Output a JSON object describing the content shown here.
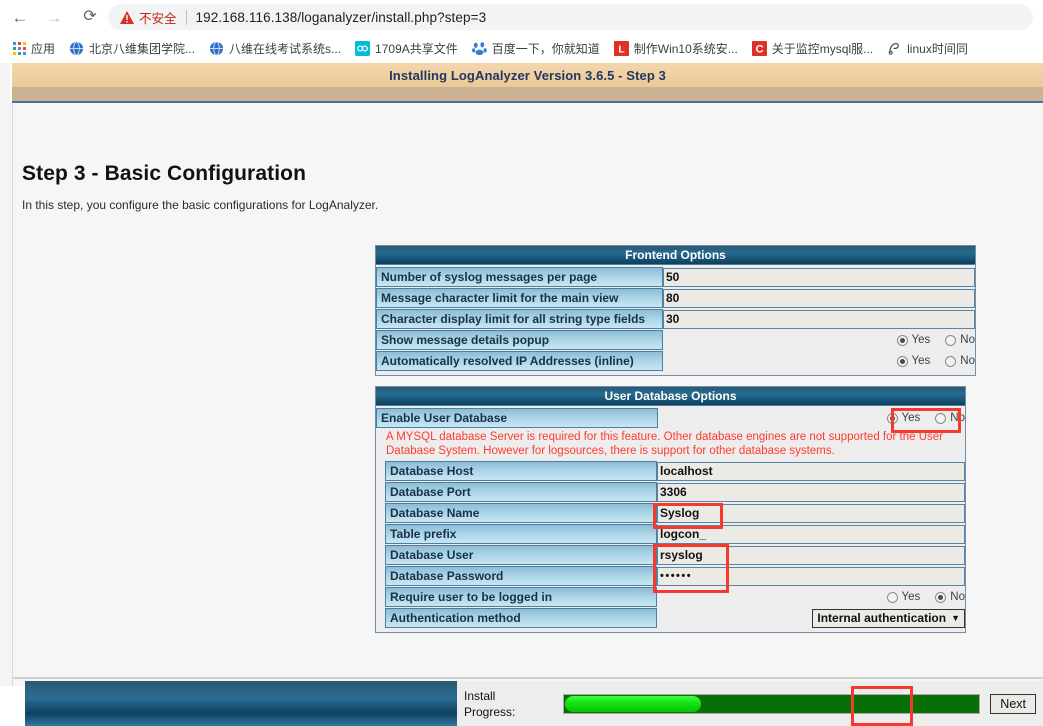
{
  "browser": {
    "back_icon": "back-arrow-icon",
    "forward_icon": "forward-arrow-icon",
    "reload_icon": "reload-icon",
    "security_label": "不安全",
    "url": "192.168.116.138/loganalyzer/install.php?step=3",
    "apps_label": "应用",
    "bookmarks": [
      {
        "label": "北京八维集团学院...",
        "icon": "globe-icon",
        "color": "#2f6fc4"
      },
      {
        "label": "八维在线考试系统s...",
        "icon": "globe-icon",
        "color": "#2f6fc4"
      },
      {
        "label": "1709A共享文件",
        "icon": "link-icon",
        "color": "#00bcd4"
      },
      {
        "label": "百度一下，你就知道",
        "icon": "baidu-icon",
        "color": "#2f7fd4"
      },
      {
        "label": "制作Win10系统安...",
        "icon": "letter-l-icon",
        "color": "#e03127"
      },
      {
        "label": "关于监控mysql服...",
        "icon": "letter-c-icon",
        "color": "#e03127"
      },
      {
        "label": "linux时间同",
        "icon": "script-icon",
        "color": "#4a4a4a"
      }
    ]
  },
  "installer": {
    "window_title": "Installing LogAnalyzer Version 3.6.5 - Step 3",
    "page_title": "Step 3 - Basic Configuration",
    "page_subtitle": "In this step, you configure the basic configurations for LogAnalyzer.",
    "colors": {
      "title_bar_bg": "#f0cfa2",
      "title_text": "#1f3864",
      "table_header_bg": "#1d5b80",
      "label_bg": "#a9d3e6",
      "warning_text": "#ff3b30",
      "annotation": "#f4392e",
      "progress_fill": "#15e015",
      "progress_track": "#067006"
    },
    "frontend_options": {
      "header": "Frontend Options",
      "rows": [
        {
          "label": "Number of syslog messages per page",
          "type": "text",
          "value": "50"
        },
        {
          "label": "Message character limit for the main view",
          "type": "text",
          "value": "80"
        },
        {
          "label": "Character display limit for all string type fields",
          "type": "text",
          "value": "30"
        },
        {
          "label": "Show message details popup",
          "type": "radio",
          "yes": "Yes",
          "no": "No",
          "selected": "Yes"
        },
        {
          "label": "Automatically resolved IP Addresses (inline)",
          "type": "radio",
          "yes": "Yes",
          "no": "No",
          "selected": "Yes"
        }
      ]
    },
    "user_database_options": {
      "header": "User Database Options",
      "enable_row": {
        "label": "Enable User Database",
        "yes": "Yes",
        "no": "No",
        "selected": "Yes"
      },
      "warning": "A MYSQL database Server is required for this feature. Other database engines are not supported for the User Database System. However for logsources, there is support for other database systems.",
      "rows": [
        {
          "label": "Database Host",
          "type": "text",
          "value": "localhost"
        },
        {
          "label": "Database Port",
          "type": "text",
          "value": "3306"
        },
        {
          "label": "Database Name",
          "type": "text",
          "value": "Syslog"
        },
        {
          "label": "Table prefix",
          "type": "text",
          "value": "logcon_"
        },
        {
          "label": "Database User",
          "type": "text",
          "value": "rsyslog"
        },
        {
          "label": "Database Password",
          "type": "password",
          "value": "••••••"
        },
        {
          "label": "Require user to be logged in",
          "type": "radio",
          "yes": "Yes",
          "no": "No",
          "selected": "No"
        },
        {
          "label": "Authentication method",
          "type": "select",
          "value": "Internal authentication"
        }
      ]
    },
    "footer": {
      "progress_label_line1": "Install",
      "progress_label_line2": "Progress:",
      "progress_percent": 33,
      "next_label": "Next"
    }
  }
}
